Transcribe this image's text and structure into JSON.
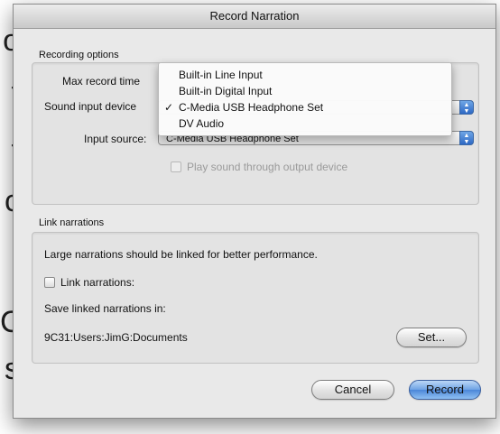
{
  "background_fragments": [
    "o",
    "t",
    "t",
    "c",
    ".",
    "C",
    "s"
  ],
  "dialog": {
    "title": "Record Narration",
    "recording": {
      "group_label": "Recording options",
      "max_record_time_label": "Max record time",
      "sound_input_device_label": "Sound input device",
      "input_source_label": "Input source:",
      "input_source_value": "C-Media USB Headphone Set",
      "play_through_label": "Play sound through output device"
    },
    "menu": {
      "items": [
        {
          "label": "Built-in Line Input",
          "checked": false
        },
        {
          "label": "Built-in Digital Input",
          "checked": false
        },
        {
          "label": "C-Media USB Headphone Set",
          "checked": true
        },
        {
          "label": "DV Audio",
          "checked": false
        }
      ],
      "check_glyph": "✓"
    },
    "link": {
      "group_label": "Link narrations",
      "description": "Large narrations should be linked for better performance.",
      "checkbox_label": "Link narrations:",
      "save_in_label": "Save linked narrations in:",
      "path": "9C31:Users:JimG:Documents",
      "set_button": "Set..."
    },
    "buttons": {
      "cancel": "Cancel",
      "record": "Record"
    }
  },
  "colors": {
    "dialog_bg": "#e9e9e9",
    "accent_blue": "#4b86d8"
  }
}
